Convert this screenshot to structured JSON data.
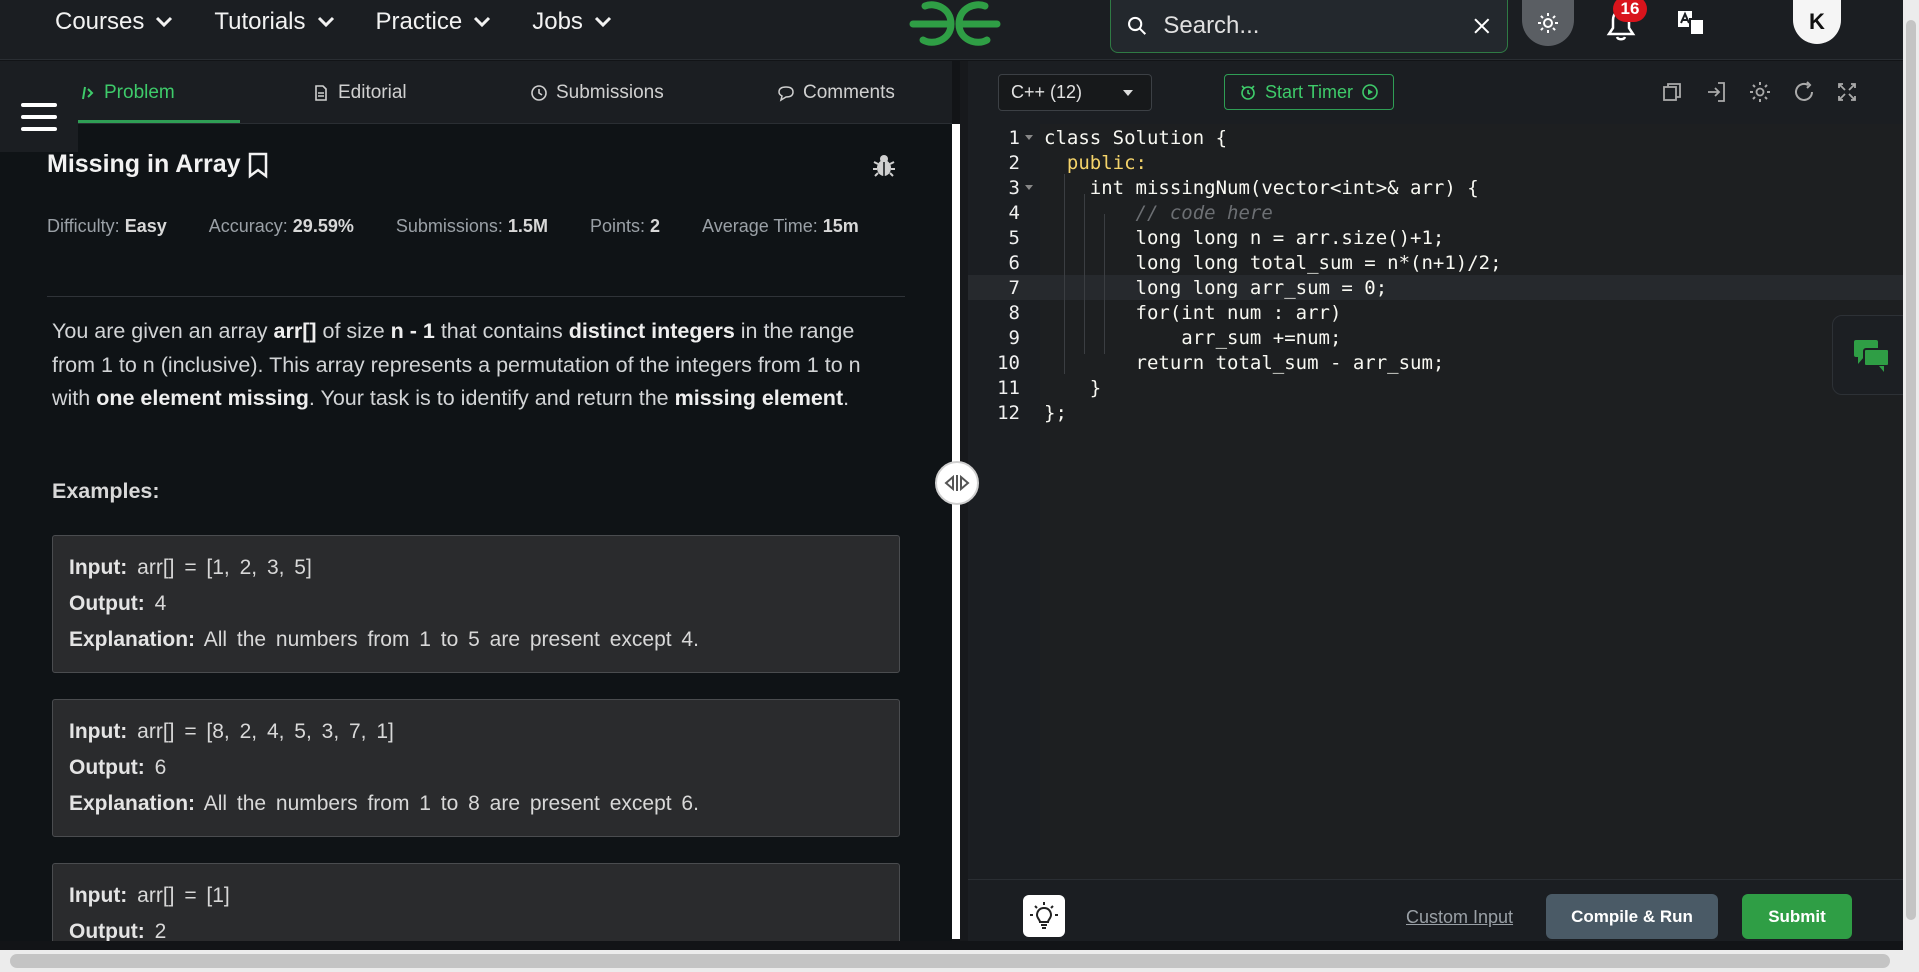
{
  "nav": {
    "links": [
      {
        "label": "Courses"
      },
      {
        "label": "Tutorials"
      },
      {
        "label": "Practice"
      },
      {
        "label": "Jobs"
      }
    ],
    "search_placeholder": "Search...",
    "notification_count": "16",
    "avatar_initial": "K"
  },
  "tabs": {
    "problem": "Problem",
    "editorial": "Editorial",
    "submissions": "Submissions",
    "comments": "Comments"
  },
  "problem": {
    "title": "Missing in Array",
    "meta": {
      "difficulty_label": "Difficulty:",
      "difficulty": "Easy",
      "accuracy_label": "Accuracy:",
      "accuracy": "29.59%",
      "submissions_label": "Submissions:",
      "submissions": "1.5M",
      "points_label": "Points:",
      "points": "2",
      "avg_time_label": "Average Time:",
      "avg_time": "15m"
    },
    "description": {
      "p1": "You are given an array ",
      "b1": "arr[]",
      "p2": " of size ",
      "b2": "n - 1",
      "p3": " that contains ",
      "b3": "distinct integers",
      "p4": " in the range from 1 to n (inclusive). This array represents a permutation of the integers from 1 to n with ",
      "b4": "one element missing",
      "p5": ". Your task is to identify and return the ",
      "b5": "missing element",
      "p6": "."
    },
    "examples_heading": "Examples:",
    "labels": {
      "input": "Input:",
      "output": "Output:",
      "explanation": "Explanation:"
    },
    "examples": [
      {
        "input": "arr[] = [1, 2, 3, 5]",
        "output": "4",
        "explanation": "All the numbers from 1 to 5 are present except 4."
      },
      {
        "input": "arr[] = [8, 2, 4, 5, 3, 7, 1]",
        "output": "6",
        "explanation": "All the numbers from 1 to 8 are present except 6."
      },
      {
        "input": "arr[] = [1]",
        "output": "2"
      }
    ]
  },
  "editor": {
    "language": "C++ (12)",
    "timer_label": "Start Timer",
    "line_numbers": [
      "1",
      "2",
      "3",
      "4",
      "5",
      "6",
      "7",
      "8",
      "9",
      "10",
      "11",
      "12"
    ],
    "code_lines": [
      "class Solution {",
      "  public:",
      "    int missingNum(vector<int>& arr) {",
      "        // code here",
      "        long long n = arr.size()+1;",
      "        long long total_sum = n*(n+1)/2;",
      "        long long arr_sum = 0;",
      "        for(int num : arr)",
      "            arr_sum +=num;",
      "        return total_sum - arr_sum;",
      "    }",
      "};"
    ],
    "custom_input": "Custom Input",
    "compile_run": "Compile & Run",
    "submit": "Submit"
  }
}
